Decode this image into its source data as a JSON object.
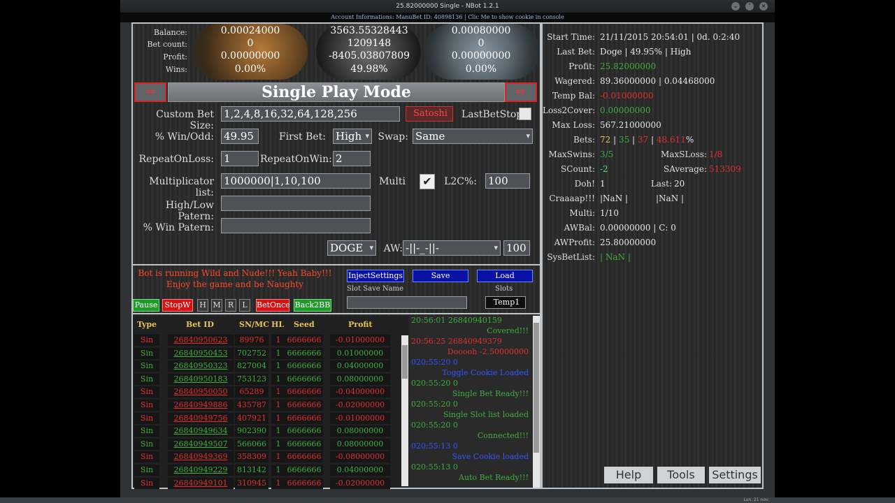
{
  "window": {
    "title": "25.82000000 Single - NBot 1.2.1",
    "account_info": "Account Informations: ManuBet ID: 40898136 | Clic Me to show cookie in console",
    "controls": [
      "⌄",
      "˄",
      "×"
    ]
  },
  "stats": {
    "labels": [
      "Balance:",
      "Bet count:",
      "Profit:",
      "Wins:"
    ],
    "coins": [
      {
        "values": [
          "0.00024000",
          "0",
          "0.00000000",
          "0.00%"
        ]
      },
      {
        "values": [
          "3563.55328443",
          "1209148",
          "-8405.03807809",
          "49.98%"
        ]
      },
      {
        "values": [
          "0.00080000",
          "0",
          "0.00000000",
          "0.00%"
        ]
      }
    ]
  },
  "mode": {
    "title": "Single Play Mode",
    "left_arrow": "⇦",
    "right_arrow": "⇨"
  },
  "form": {
    "custom_bet_label": "Custom Bet Size:",
    "custom_bet_value": "1,2,4,8,16,32,64,128,256",
    "satoshi_label": "Satoshi",
    "lastbetstop_label": "LastBetStop",
    "win_odd_label": "% Win/Odd:",
    "win_odd_value": "49.95",
    "first_bet_label": "First Bet:",
    "first_bet_value": "High",
    "swap_label": "Swap:",
    "swap_value": "Same",
    "repeat_loss_label": "RepeatOnLoss:",
    "repeat_loss_value": "1",
    "repeat_win_label": "RepeatOnWin:",
    "repeat_win_value": "2",
    "multiplicator_label": "Multiplicator list:",
    "multiplicator_value": "1000000|1,10,100",
    "multi_label": "Multi",
    "multi_checked": "✔",
    "l2c_label": "L2C%:",
    "l2c_value": "100",
    "highlow_label": "High/Low Patern:",
    "highlow_value": "",
    "winpat_label": "% Win Patern:",
    "winpat_value": "",
    "coin_value": "DOGE",
    "aw_label": "AW:",
    "aw_value": "-||-_-||-",
    "aw_num": "100"
  },
  "status": {
    "line1": "Bot is running Wild and Nude!!! Yeah Baby!!!",
    "line2": "Enjoy the game and be Naughty"
  },
  "actions": {
    "inject": "InjectSettings",
    "save": "Save",
    "load": "Load",
    "slot_save_name": "Slot Save Name",
    "slots_label": "Slots",
    "slot_value": "Temp1",
    "pause": "Pause",
    "stopw": "StopW",
    "h": "H",
    "m": "M",
    "r": "R",
    "l": "L",
    "betonce": "BetOnce",
    "back2bb": "Back2BB"
  },
  "table": {
    "headers": [
      "Type",
      "Bet ID",
      "SN/MC",
      "HL",
      "Seed",
      "Profit"
    ],
    "rows": [
      {
        "type": "Sin",
        "id": "26840950623",
        "sn": "89976",
        "hl": "1",
        "seed": "6666666",
        "profit": "-0.01000000",
        "win": false
      },
      {
        "type": "Sin",
        "id": "26840950453",
        "sn": "702752",
        "hl": "1",
        "seed": "6666666",
        "profit": "0.01000000",
        "win": true
      },
      {
        "type": "Sin",
        "id": "26840950323",
        "sn": "827004",
        "hl": "1",
        "seed": "6666666",
        "profit": "0.04000000",
        "win": true
      },
      {
        "type": "Sin",
        "id": "26840950183",
        "sn": "753123",
        "hl": "1",
        "seed": "6666666",
        "profit": "0.08000000",
        "win": true
      },
      {
        "type": "Sin",
        "id": "26840950050",
        "sn": "65289",
        "hl": "1",
        "seed": "6666666",
        "profit": "-0.04000000",
        "win": false
      },
      {
        "type": "Sin",
        "id": "26840949886",
        "sn": "435787",
        "hl": "1",
        "seed": "6666666",
        "profit": "-0.02000000",
        "win": false
      },
      {
        "type": "Sin",
        "id": "26840949756",
        "sn": "407921",
        "hl": "1",
        "seed": "6666666",
        "profit": "-0.01000000",
        "win": false
      },
      {
        "type": "Sin",
        "id": "26840949634",
        "sn": "902390",
        "hl": "1",
        "seed": "6666666",
        "profit": "0.08000000",
        "win": true
      },
      {
        "type": "Sin",
        "id": "26840949507",
        "sn": "566066",
        "hl": "1",
        "seed": "6666666",
        "profit": "0.08000000",
        "win": true
      },
      {
        "type": "Sin",
        "id": "26840949369",
        "sn": "358309",
        "hl": "1",
        "seed": "6666666",
        "profit": "-0.08000000",
        "win": false
      },
      {
        "type": "Sin",
        "id": "26840949229",
        "sn": "813142",
        "hl": "1",
        "seed": "6666666",
        "profit": "0.04000000",
        "win": true
      },
      {
        "type": "Sin",
        "id": "26840949101",
        "sn": "310945",
        "hl": "1",
        "seed": "6666666",
        "profit": "-0.02000000",
        "win": false
      }
    ]
  },
  "log": [
    {
      "text": "20:56:01 26840940159",
      "color": "#3fae3f",
      "align": "left"
    },
    {
      "text": "Covered!!!",
      "color": "#3fae3f",
      "align": "right"
    },
    {
      "text": "20:56:25 26840949379",
      "color": "#e03030",
      "align": "left"
    },
    {
      "text": "Dooooh -2.50000000",
      "color": "#e03030",
      "align": "right"
    },
    {
      "text": "020:55:20 0",
      "color": "#3355ff",
      "align": "left"
    },
    {
      "text": "Toggle Cookie Loaded",
      "color": "#3355ff",
      "align": "right"
    },
    {
      "text": "020:55:20 0",
      "color": "#3fae3f",
      "align": "left"
    },
    {
      "text": "Single Bet Ready!!!",
      "color": "#3fae3f",
      "align": "right"
    },
    {
      "text": "020:55:20 0",
      "color": "#3fae3f",
      "align": "left"
    },
    {
      "text": "Single Slot list loaded",
      "color": "#3fae3f",
      "align": "right"
    },
    {
      "text": "020:55:20 0",
      "color": "#3fae3f",
      "align": "left"
    },
    {
      "text": "Connected!!!",
      "color": "#3fae3f",
      "align": "right"
    },
    {
      "text": "020:55:13 0",
      "color": "#3355ff",
      "align": "left"
    },
    {
      "text": "Save Cookie loaded",
      "color": "#3355ff",
      "align": "right"
    },
    {
      "text": "020:55:13 0",
      "color": "#3fae3f",
      "align": "left"
    },
    {
      "text": "Auto Bet Ready!!!",
      "color": "#3fae3f",
      "align": "right"
    }
  ],
  "right": {
    "start_time_label": "Start Time:",
    "start_time": "21/11/2015 20:54:01 | 0d. 0:2:40",
    "last_bet_label": "Last Bet:",
    "last_bet": "Doge | 49.95% | High",
    "profit_label": "Profit:",
    "profit": "25.82000000",
    "wagered_label": "Wagered:",
    "wagered": "89.36000000 | 0.04468000",
    "temp_bal_label": "Temp Bal:",
    "temp_bal": "-0.01000000",
    "loss2cover_label": "Loss2Cover:",
    "loss2cover": "0.00000000",
    "max_loss_label": "Max Loss:",
    "max_loss": "567.21000000",
    "bets_label": "Bets:",
    "bets_total": "72",
    "bets_win": "35",
    "bets_lose": "37",
    "bets_pct": "48.611",
    "pct_sign": "%",
    "maxswins_label": "MaxSwins:",
    "maxswins": "3/5",
    "maxsloss_label": "MaxSLoss:",
    "maxsloss": "1/8",
    "scount_label": "SCount:",
    "scount": "-2",
    "saverage_label": "SAverage:",
    "saverage": "513309",
    "doh_label": "Doh!",
    "doh": "1",
    "last_label": "Last:",
    "last": "20",
    "craaap_label": "Craaaap!!!",
    "craaap1": "|NaN |",
    "craaap2": "|NaN |",
    "multi_label": "Multi:",
    "multi": "1/10",
    "awbal_label": "AWBal:",
    "awbal": "0.00000000 | C: 0",
    "awprofit_label": "AWProfit:",
    "awprofit": "25.80000000",
    "sysbetlist_label": "SysBetList:",
    "sysbetlist": "| NaN |",
    "help": "Help",
    "tools": "Tools",
    "settings": "Settings"
  },
  "taskbar": {
    "clock": "Lun. 21 nov."
  }
}
